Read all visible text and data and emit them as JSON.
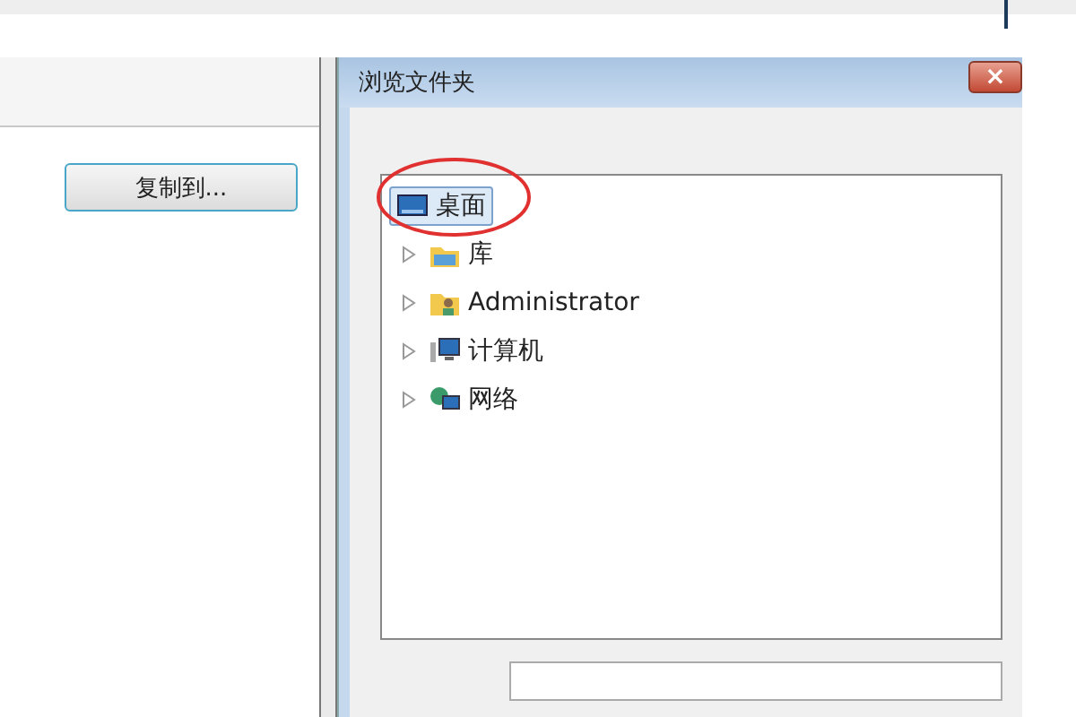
{
  "left_panel": {
    "button": "复制到..."
  },
  "dialog": {
    "title": "浏览文件夹",
    "close": "×",
    "tree": [
      {
        "label": "桌面",
        "kind": "root",
        "selected": true
      },
      {
        "label": "库",
        "kind": "node",
        "selected": false,
        "expanded": false
      },
      {
        "label": "Administrator",
        "kind": "node",
        "selected": false,
        "expanded": false
      },
      {
        "label": "计算机",
        "kind": "node",
        "selected": false,
        "expanded": false
      },
      {
        "label": "网络",
        "kind": "node",
        "selected": false,
        "expanded": false
      }
    ]
  }
}
